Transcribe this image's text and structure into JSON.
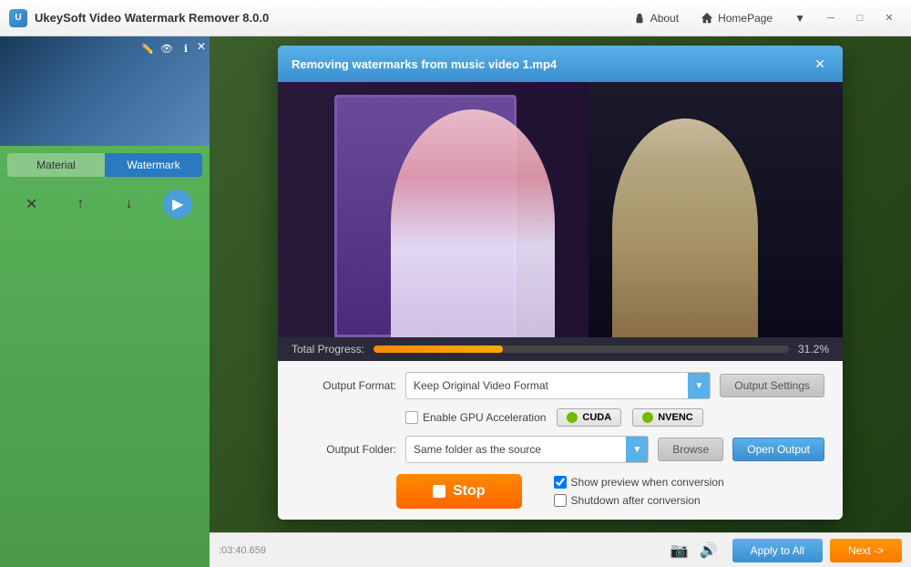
{
  "titlebar": {
    "app_name": "UkeySoft Video Watermark Remover 8.0.0",
    "about_label": "About",
    "homepage_label": "HomePage"
  },
  "sidebar": {
    "tabs": {
      "material_label": "Material",
      "watermark_label": "Watermark"
    }
  },
  "modal": {
    "title": "Removing watermarks from music video 1.mp4",
    "progress": {
      "label": "Total Progress:",
      "value": 31.2,
      "display": "31.2%"
    },
    "output_format": {
      "label": "Output Format:",
      "value": "Keep Original Video Format",
      "settings_label": "Output Settings"
    },
    "gpu": {
      "label": "Enable GPU Acceleration",
      "cuda_label": "CUDA",
      "nvenc_label": "NVENC"
    },
    "output_folder": {
      "label": "Output Folder:",
      "value": "Same folder as the source",
      "browse_label": "Browse",
      "open_label": "Open Output"
    },
    "stop_label": "Stop",
    "show_preview_label": "Show preview when conversion",
    "shutdown_label": "Shutdown after conversion"
  },
  "footer": {
    "apply_label": "Apply to All",
    "next_label": "Next ->"
  }
}
